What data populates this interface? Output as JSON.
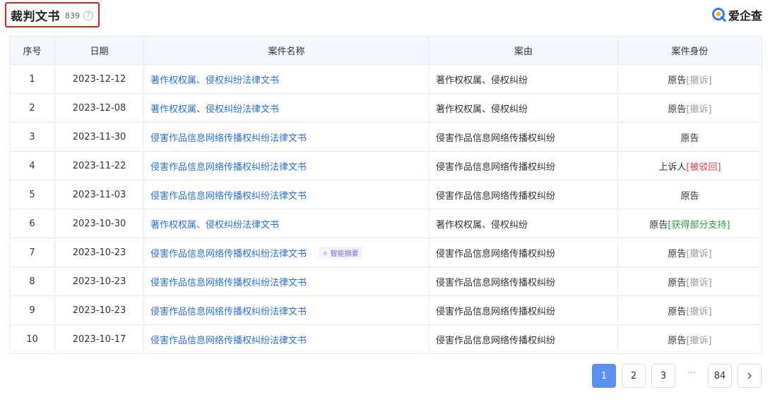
{
  "header": {
    "title": "裁判文书",
    "count": "839",
    "help_symbol": "?",
    "brand_name": "爱企查"
  },
  "table": {
    "headers": [
      "序号",
      "日期",
      "案件名称",
      "案由",
      "案件身份"
    ],
    "rows": [
      {
        "no": "1",
        "date": "2023-12-12",
        "name": "著作权权属、侵权纠纷法律文书",
        "cause": "著作权权属、侵权纠纷",
        "role": "原告",
        "status": "[撤诉]",
        "status_type": "gray"
      },
      {
        "no": "2",
        "date": "2023-12-08",
        "name": "著作权权属、侵权纠纷法律文书",
        "cause": "著作权权属、侵权纠纷",
        "role": "原告",
        "status": "[撤诉]",
        "status_type": "gray"
      },
      {
        "no": "3",
        "date": "2023-11-30",
        "name": "侵害作品信息网络传播权纠纷法律文书",
        "cause": "侵害作品信息网络传播权纠纷",
        "role": "原告",
        "status": "",
        "status_type": "none"
      },
      {
        "no": "4",
        "date": "2023-11-22",
        "name": "侵害作品信息网络传播权纠纷法律文书",
        "cause": "侵害作品信息网络传播权纠纷",
        "role": "上诉人",
        "status": "[被驳回]",
        "status_type": "red"
      },
      {
        "no": "5",
        "date": "2023-11-03",
        "name": "侵害作品信息网络传播权纠纷法律文书",
        "cause": "侵害作品信息网络传播权纠纷",
        "role": "原告",
        "status": "",
        "status_type": "none"
      },
      {
        "no": "6",
        "date": "2023-10-30",
        "name": "著作权权属、侵权纠纷法律文书",
        "cause": "著作权权属、侵权纠纷",
        "role": "原告",
        "status": "[获得部分支持]",
        "status_type": "green"
      },
      {
        "no": "7",
        "date": "2023-10-23",
        "name": "侵害作品信息网络传播权纠纷法律文书",
        "cause": "侵害作品信息网络传播权纠纷",
        "role": "原告",
        "status": "[撤诉]",
        "status_type": "gray",
        "tag": "智能摘要"
      },
      {
        "no": "8",
        "date": "2023-10-23",
        "name": "侵害作品信息网络传播权纠纷法律文书",
        "cause": "侵害作品信息网络传播权纠纷",
        "role": "原告",
        "status": "[撤诉]",
        "status_type": "gray"
      },
      {
        "no": "9",
        "date": "2023-10-23",
        "name": "侵害作品信息网络传播权纠纷法律文书",
        "cause": "侵害作品信息网络传播权纠纷",
        "role": "原告",
        "status": "[撤诉]",
        "status_type": "gray"
      },
      {
        "no": "10",
        "date": "2023-10-17",
        "name": "侵害作品信息网络传播权纠纷法律文书",
        "cause": "侵害作品信息网络传播权纠纷",
        "role": "原告",
        "status": "[撤诉]",
        "status_type": "gray"
      }
    ]
  },
  "pagination": {
    "pages": [
      "1",
      "2",
      "3"
    ],
    "current": "1",
    "ellipsis": "···",
    "last": "84",
    "next_icon": "chevron-right-icon"
  },
  "colors": {
    "link": "#2a6fd6",
    "highlight_border": "#e02020",
    "active_page": "#5b8ff0",
    "status_gray": "#999999",
    "status_red": "#e04040",
    "status_green": "#2e9a45"
  }
}
